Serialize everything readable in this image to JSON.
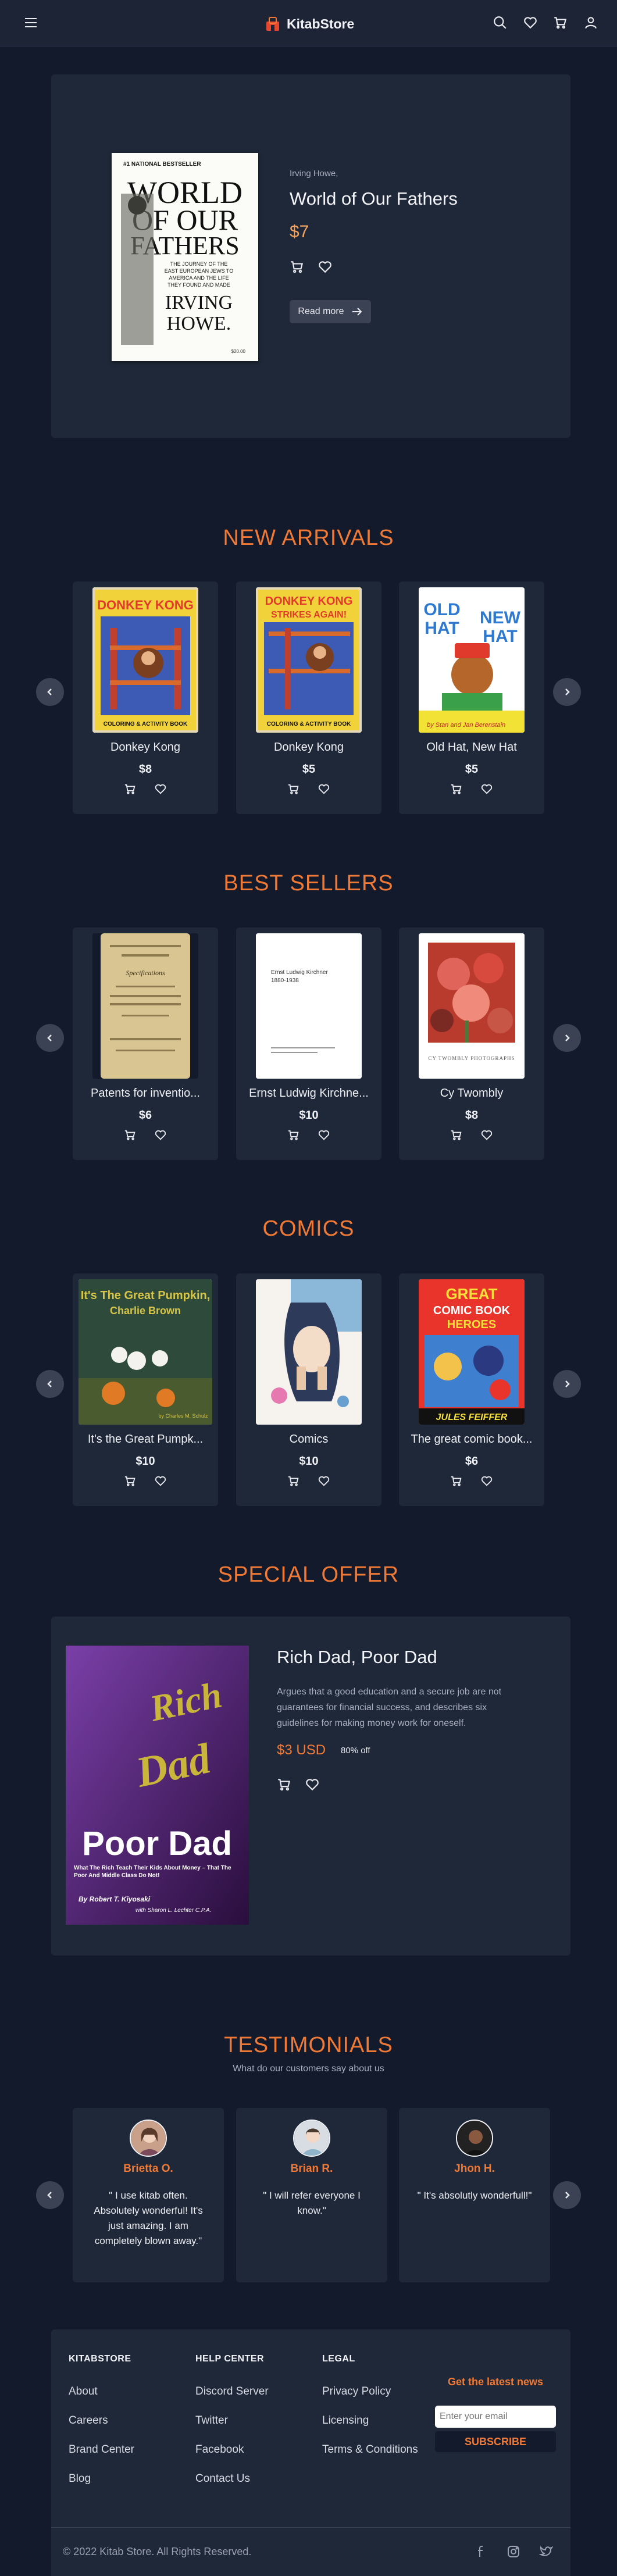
{
  "brand": {
    "name": "KitabStore",
    "accent": "#f07a35"
  },
  "nav": {
    "icons": [
      "menu-icon",
      "search-icon",
      "heart-icon",
      "cart-icon",
      "user-icon"
    ]
  },
  "hero": {
    "author": "Irving Howe,",
    "title": "World of Our Fathers",
    "price": "$7",
    "read_more": "Read more",
    "cover": {
      "badge": "#1 NATIONAL BESTSELLER",
      "line1": "WORLD",
      "line2": "OF OUR",
      "line3": "FATHERS",
      "subtitle": "THE JOURNEY OF THE EAST EUROPEAN JEWS TO AMERICA AND THE LIFE THEY FOUND AND MADE",
      "author_line1": "IRVING",
      "author_line2": "HOWE.",
      "price_tag": "$20.00"
    }
  },
  "new_arrivals": {
    "title": "NEW ARRIVALS",
    "items": [
      {
        "title": "Donkey Kong",
        "price": "$8",
        "cover": {
          "line1": "DONKEY KONG",
          "footer": "COLORING & ACTIVITY BOOK"
        }
      },
      {
        "title": "Donkey Kong",
        "price": "$5",
        "cover": {
          "line1": "DONKEY KONG",
          "line2": "STRIKES AGAIN!",
          "footer": "COLORING & ACTIVITY BOOK"
        }
      },
      {
        "title": "Old Hat, New Hat",
        "price": "$5",
        "cover": {
          "line1": "OLD",
          "line2": "HAT",
          "line3": "NEW",
          "line4": "HAT",
          "byline": "by Stan and Jan Berenstain"
        }
      }
    ]
  },
  "best_sellers": {
    "title": "BEST SELLERS",
    "items": [
      {
        "title": "Patents for inventio...",
        "price": "$6",
        "cover": {
          "line1": "Specifications"
        }
      },
      {
        "title": "Ernst Ludwig Kirchne...",
        "price": "$10",
        "cover": {
          "line1": "Ernst Ludwig Kirchner",
          "line2": "1880-1938"
        }
      },
      {
        "title": "Cy Twombly",
        "price": "$8",
        "cover": {
          "line1": "CY TWOMBLY PHOTOGRAPHS"
        }
      }
    ]
  },
  "comics": {
    "title": "COMICS",
    "items": [
      {
        "title": "It's the Great Pumpk...",
        "price": "$10",
        "cover": {
          "line1": "It's The Great Pumpkin,",
          "line2": "Charlie Brown",
          "byline": "by Charles M. Schulz"
        }
      },
      {
        "title": "Comics",
        "price": "$10",
        "cover": {}
      },
      {
        "title": "The great comic book...",
        "price": "$6",
        "cover": {
          "line1": "GREAT",
          "line2": "COMIC BOOK",
          "line3": "HEROES",
          "byline": "JULES FEIFFER"
        }
      }
    ]
  },
  "special_offer": {
    "section_title": "SPECIAL OFFER",
    "title": "Rich Dad, Poor Dad",
    "description": "Argues that a good education and a secure job are not guarantees for financial success, and describes six guidelines for making money work for oneself.",
    "price": "$3 USD",
    "discount": "80% off",
    "cover": {
      "line1": "Rich",
      "line2": "Dad",
      "line3": "Poor Dad",
      "tag": "What The Rich Teach Their Kids About Money – That The Poor And Middle Class Do Not!",
      "author": "By Robert T. Kiyosaki",
      "coauthor": "with Sharon L. Lechter C.P.A."
    }
  },
  "testimonials": {
    "title": "TESTIMONIALS",
    "subtitle": "What do our customers say about us",
    "items": [
      {
        "name": "Brietta O.",
        "quote": "\" I use kitab often. Absolutely wonderful! It's just amazing. I am completely blown away.\""
      },
      {
        "name": "Brian R.",
        "quote": "\" I will refer everyone I know.\""
      },
      {
        "name": "Jhon H.",
        "quote": "\" It's absolutly wonderfull!\""
      }
    ]
  },
  "footer": {
    "columns": [
      {
        "heading": "KITABSTORE",
        "links": [
          "About",
          "Careers",
          "Brand Center",
          "Blog"
        ]
      },
      {
        "heading": "HELP CENTER",
        "links": [
          "Discord Server",
          "Twitter",
          "Facebook",
          "Contact Us"
        ]
      },
      {
        "heading": "LEGAL",
        "links": [
          "Privacy Policy",
          "Licensing",
          "Terms & Conditions"
        ]
      }
    ],
    "newsletter": {
      "title": "Get the latest news",
      "placeholder": "Enter your email",
      "button": "SUBSCRIBE"
    },
    "copyright": "© 2022 Kitab Store. All Rights Reserved.",
    "socials": [
      "facebook-icon",
      "instagram-icon",
      "twitter-icon"
    ]
  }
}
